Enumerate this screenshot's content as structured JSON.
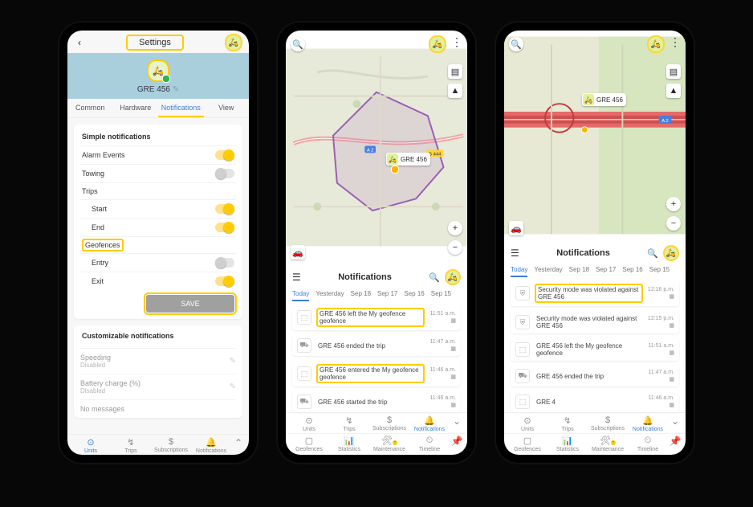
{
  "settings": {
    "title": "Settings",
    "unit_name": "GRE 456",
    "tabs": [
      "Common",
      "Hardware",
      "Notifications",
      "View"
    ],
    "active_tab": 2,
    "simple_title": "Simple notifications",
    "rows": {
      "alarm": "Alarm Events",
      "towing": "Towing",
      "trips": "Trips",
      "start": "Start",
      "end": "End",
      "geofences": "Geofences",
      "entry": "Entry",
      "exit": "Exit"
    },
    "save": "SAVE",
    "custom_title": "Customizable notifications",
    "custom": [
      {
        "l1": "Speeding",
        "l2": "Disabled"
      },
      {
        "l1": "Battery charge (%)",
        "l2": "Disabled"
      },
      {
        "l1": "No messages",
        "l2": ""
      }
    ],
    "nav1": [
      "Units",
      "Trips",
      "Subscriptions",
      "Notifications"
    ]
  },
  "notif": {
    "title": "Notifications",
    "date_tabs": [
      "Today",
      "Yesterday",
      "Sep 18",
      "Sep 17",
      "Sep 16",
      "Sep 15"
    ],
    "unit_label": "GRE 456",
    "screen2": [
      {
        "ic": "⬚",
        "txt": "GRE 456 left the My geofence geofence",
        "time": "11:51 a.m.",
        "hl": true
      },
      {
        "ic": "⛟",
        "txt": "GRE 456 ended the trip",
        "time": "11:47 a.m.",
        "hl": false
      },
      {
        "ic": "⬚",
        "txt": "GRE 456 entered the My geofence geofence",
        "time": "11:46 a.m.",
        "hl": true
      },
      {
        "ic": "⛟",
        "txt": "GRE 456 started the trip",
        "time": "11:46 a.m.",
        "hl": false
      }
    ],
    "screen3": [
      {
        "ic": "⛨",
        "txt": "Security mode was violated against GRE 456",
        "time": "12:16 p.m.",
        "hl": true
      },
      {
        "ic": "⛨",
        "txt": "Security mode was violated against GRE 456",
        "time": "12:15 p.m.",
        "hl": false
      },
      {
        "ic": "⬚",
        "txt": "GRE 456 left the My geofence geofence",
        "time": "11:51 a.m.",
        "hl": false
      },
      {
        "ic": "⛟",
        "txt": "GRE 456 ended the trip",
        "time": "11:47 a.m.",
        "hl": false
      },
      {
        "ic": "⬚",
        "txt": "GRE 4",
        "time": "11:46 a.m.",
        "hl": false
      }
    ],
    "nav1": [
      "Units",
      "Trips",
      "Subscriptions",
      "Notifications"
    ],
    "nav2": [
      "Geofences",
      "Statistics",
      "Maintenance",
      "Timeline"
    ]
  },
  "roads": {
    "b444": "B 444",
    "a2": "A 2"
  }
}
